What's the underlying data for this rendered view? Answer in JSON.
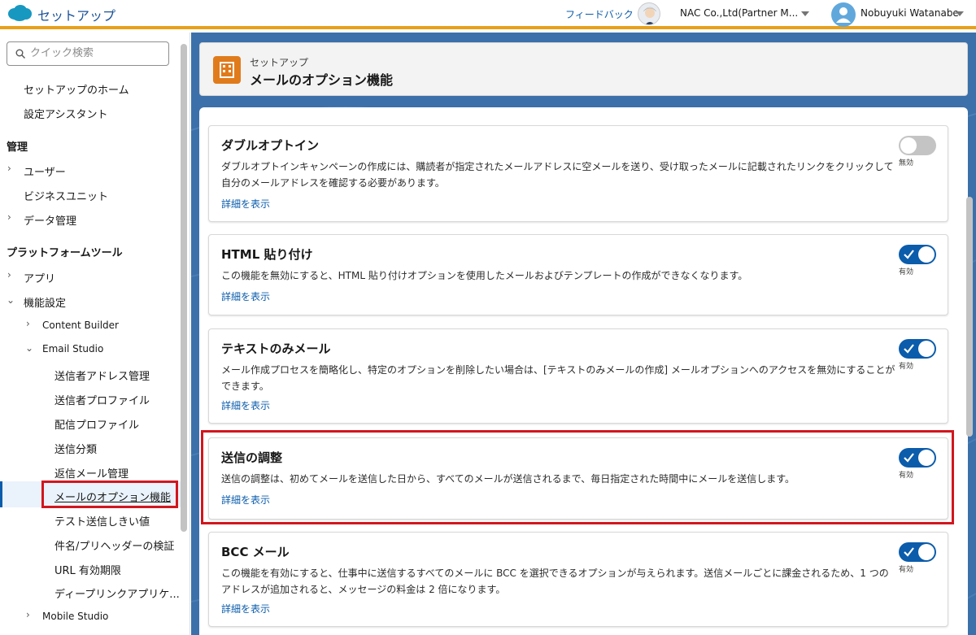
{
  "header": {
    "app_title": "セットアップ",
    "feedback": "フィードバック",
    "org": "NAC Co.,Ltd(Partner M...",
    "user": "Nobuyuki Watanabe",
    "brand_color": "#1798c1",
    "accent_color": "#e8a01a"
  },
  "sidebar": {
    "search_placeholder": "クイック検索",
    "setup_home": "セットアップのホーム",
    "setup_assistant": "設定アシスタント",
    "admin_header": "管理",
    "users": "ユーザー",
    "business_units": "ビジネスユニット",
    "data_management": "データ管理",
    "platform_tools_header": "プラットフォームツール",
    "apps": "アプリ",
    "feature_settings": "機能設定",
    "content_builder": "Content Builder",
    "email_studio": "Email Studio",
    "sender_address": "送信者アドレス管理",
    "sender_profile": "送信者プロファイル",
    "delivery_profile": "配信プロファイル",
    "send_classification": "送信分類",
    "reply_mail": "返信メール管理",
    "email_options": "メールのオプション機能",
    "test_threshold": "テスト送信しきい値",
    "subject_preheader": "件名/プリヘッダーの検証",
    "url_expiry": "URL 有効期限",
    "deep_link": "ディープリンクアプリケ...",
    "mobile_studio": "Mobile Studio"
  },
  "page": {
    "breadcrumb": "セットアップ",
    "title": "メールのオプション機能"
  },
  "cards": [
    {
      "title": "ダブルオプトイン",
      "desc": "ダブルオプトインキャンペーンの作成には、購読者が指定されたメールアドレスに空メールを送り、受け取ったメールに記載されたリンクをクリックして自分のメールアドレスを確認する必要があります。",
      "link": "詳細を表示",
      "enabled": false,
      "state_label": "無効"
    },
    {
      "title": "HTML 貼り付け",
      "desc": "この機能を無効にすると、HTML 貼り付けオプションを使用したメールおよびテンプレートの作成ができなくなります。",
      "link": "詳細を表示",
      "enabled": true,
      "state_label": "有効"
    },
    {
      "title": "テキストのみメール",
      "desc": "メール作成プロセスを簡略化し、特定のオプションを削除したい場合は、[テキストのみメールの作成] メールオプションへのアクセスを無効にすることができます。",
      "link": "詳細を表示",
      "enabled": true,
      "state_label": "有効"
    },
    {
      "title": "送信の調整",
      "desc": "送信の調整は、初めてメールを送信した日から、すべてのメールが送信されるまで、毎日指定された時間中にメールを送信します。",
      "link": "詳細を表示",
      "enabled": true,
      "state_label": "有効"
    },
    {
      "title": "BCC メール",
      "desc": "この機能を有効にすると、仕事中に送信するすべてのメールに BCC を選択できるオプションが与えられます。送信メールごとに課金されるため、1 つのアドレスが追加されると、メッセージの料金は 2 倍になります。",
      "link": "詳細を表示",
      "enabled": true,
      "state_label": "有効"
    }
  ]
}
